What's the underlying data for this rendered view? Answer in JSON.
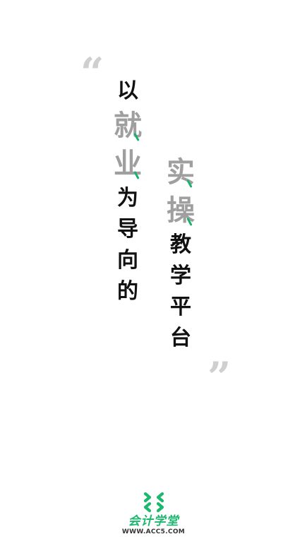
{
  "quotes": {
    "open": "“",
    "close": "”"
  },
  "slogan": {
    "left_column": [
      {
        "char": "以",
        "style": "small",
        "accent": false
      },
      {
        "char": "就",
        "style": "big",
        "accent": true
      },
      {
        "char": "业",
        "style": "big",
        "accent": true
      },
      {
        "char": "为",
        "style": "small",
        "accent": false
      },
      {
        "char": "导",
        "style": "small",
        "accent": false
      },
      {
        "char": "向",
        "style": "small",
        "accent": false
      },
      {
        "char": "的",
        "style": "small",
        "accent": false
      }
    ],
    "right_column": [
      {
        "char": "实",
        "style": "big",
        "accent": true
      },
      {
        "char": "操",
        "style": "big",
        "accent": true
      },
      {
        "char": "教",
        "style": "small",
        "accent": false
      },
      {
        "char": "学",
        "style": "small",
        "accent": false
      },
      {
        "char": "平",
        "style": "small",
        "accent": false
      },
      {
        "char": "台",
        "style": "small",
        "accent": false
      }
    ]
  },
  "brand": {
    "name": "会计学堂",
    "url": "WWW.ACC5.COM",
    "logo_icon": "chevron-cross-icon"
  },
  "colors": {
    "accent": "#18b36b",
    "brand_green": "#1db86f",
    "gray_text": "#9f9f9f",
    "dark_text": "#111111",
    "quote": "#cfcfcf"
  }
}
